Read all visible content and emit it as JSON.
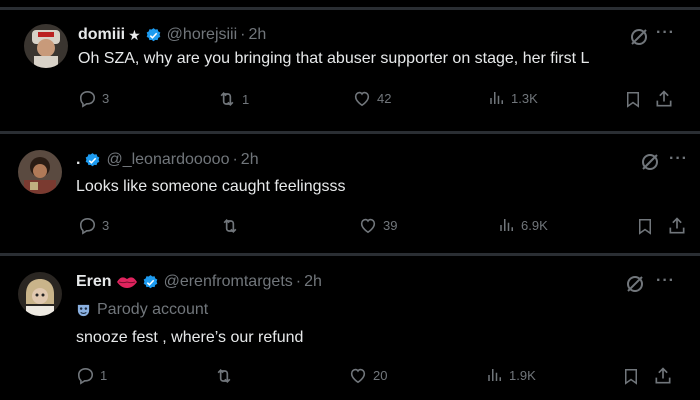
{
  "tweets": [
    {
      "display_name": "domiii",
      "name_suffix": "★",
      "handle": "@horejsiii",
      "time": "2h",
      "text": "Oh SZA, why are you bringing that abuser supporter on stage, her first L",
      "replies": "3",
      "retweets": "1",
      "likes": "42",
      "views": "1.3K"
    },
    {
      "display_name": ".",
      "handle": "@_leonardooooo",
      "time": "2h",
      "text": "Looks like someone caught feelingsss",
      "replies": "3",
      "retweets": "",
      "likes": "39",
      "views": "6.9K"
    },
    {
      "display_name": "Eren",
      "handle": "@erenfromtargets",
      "time": "2h",
      "parody_label": "Parody account",
      "text": "snooze fest , where’s our refund",
      "replies": "1",
      "retweets": "",
      "likes": "20",
      "views": "1.9K"
    }
  ],
  "colors": {
    "background": "#000000",
    "text": "#e7e9ea",
    "muted": "#71767b",
    "verified": "#1d9bf0",
    "separator": "#2a2e33"
  },
  "icons": [
    "reply-icon",
    "retweet-icon",
    "like-icon",
    "views-icon",
    "bookmark-icon",
    "share-icon",
    "grok-icon",
    "more-icon",
    "verified-badge-icon",
    "lips-emoji-icon",
    "parody-mask-icon"
  ]
}
